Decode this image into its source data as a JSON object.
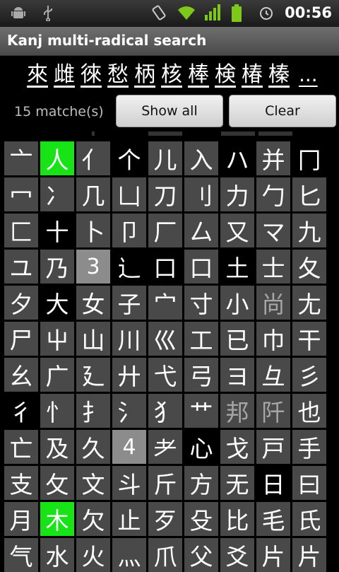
{
  "status_bar": {
    "time": "00:56",
    "icons": [
      "android-debug-icon",
      "usb-icon",
      "vibrate-icon",
      "wifi-icon",
      "signal-icon",
      "battery-icon",
      "alarm-icon"
    ]
  },
  "app": {
    "title": "Kanj multi-radical search"
  },
  "results": {
    "kanji": [
      "來",
      "雌",
      "徠",
      "愁",
      "柄",
      "核",
      "棒",
      "検",
      "椿",
      "榛"
    ],
    "more": "..."
  },
  "controls": {
    "matches_text": "15 matche(s)",
    "show_all_label": "Show all",
    "clear_label": "Clear"
  },
  "radicals": [
    {
      "c": "亠",
      "s": "normal"
    },
    {
      "c": "人",
      "s": "selected"
    },
    {
      "c": "亻",
      "s": "normal"
    },
    {
      "c": "个",
      "s": "black"
    },
    {
      "c": "儿",
      "s": "normal"
    },
    {
      "c": "入",
      "s": "normal"
    },
    {
      "c": "ハ",
      "s": "black"
    },
    {
      "c": "并",
      "s": "normal"
    },
    {
      "c": "冂",
      "s": "black"
    },
    {
      "c": "冖",
      "s": "normal"
    },
    {
      "c": "冫",
      "s": "normal"
    },
    {
      "c": "几",
      "s": "normal"
    },
    {
      "c": "凵",
      "s": "normal"
    },
    {
      "c": "刀",
      "s": "normal"
    },
    {
      "c": "刂",
      "s": "normal"
    },
    {
      "c": "力",
      "s": "normal"
    },
    {
      "c": "勹",
      "s": "normal"
    },
    {
      "c": "匕",
      "s": "normal"
    },
    {
      "c": "匚",
      "s": "normal"
    },
    {
      "c": "十",
      "s": "black"
    },
    {
      "c": "卜",
      "s": "normal"
    },
    {
      "c": "卩",
      "s": "normal"
    },
    {
      "c": "厂",
      "s": "normal"
    },
    {
      "c": "厶",
      "s": "normal"
    },
    {
      "c": "又",
      "s": "normal"
    },
    {
      "c": "マ",
      "s": "normal"
    },
    {
      "c": "九",
      "s": "normal"
    },
    {
      "c": "ユ",
      "s": "normal"
    },
    {
      "c": "乃",
      "s": "normal"
    },
    {
      "c": "3",
      "s": "number"
    },
    {
      "c": "⻌",
      "s": "black"
    },
    {
      "c": "口",
      "s": "black"
    },
    {
      "c": "口",
      "s": "normal"
    },
    {
      "c": "土",
      "s": "black"
    },
    {
      "c": "士",
      "s": "normal"
    },
    {
      "c": "夂",
      "s": "normal"
    },
    {
      "c": "夕",
      "s": "normal"
    },
    {
      "c": "大",
      "s": "black"
    },
    {
      "c": "女",
      "s": "normal"
    },
    {
      "c": "子",
      "s": "normal"
    },
    {
      "c": "宀",
      "s": "normal"
    },
    {
      "c": "寸",
      "s": "normal"
    },
    {
      "c": "小",
      "s": "normal"
    },
    {
      "c": "尚",
      "s": "dim"
    },
    {
      "c": "尢",
      "s": "normal"
    },
    {
      "c": "尸",
      "s": "normal"
    },
    {
      "c": "屮",
      "s": "normal"
    },
    {
      "c": "山",
      "s": "normal"
    },
    {
      "c": "川",
      "s": "normal"
    },
    {
      "c": "巛",
      "s": "normal"
    },
    {
      "c": "工",
      "s": "normal"
    },
    {
      "c": "已",
      "s": "normal"
    },
    {
      "c": "巾",
      "s": "normal"
    },
    {
      "c": "干",
      "s": "normal"
    },
    {
      "c": "幺",
      "s": "normal"
    },
    {
      "c": "广",
      "s": "normal"
    },
    {
      "c": "廴",
      "s": "normal"
    },
    {
      "c": "廾",
      "s": "normal"
    },
    {
      "c": "弋",
      "s": "normal"
    },
    {
      "c": "弓",
      "s": "normal"
    },
    {
      "c": "ヨ",
      "s": "normal"
    },
    {
      "c": "彑",
      "s": "normal"
    },
    {
      "c": "彡",
      "s": "normal"
    },
    {
      "c": "彳",
      "s": "black"
    },
    {
      "c": "忄",
      "s": "normal"
    },
    {
      "c": "扌",
      "s": "normal"
    },
    {
      "c": "氵",
      "s": "normal"
    },
    {
      "c": "犭",
      "s": "normal"
    },
    {
      "c": "艹",
      "s": "normal"
    },
    {
      "c": "邦",
      "s": "dim"
    },
    {
      "c": "阡",
      "s": "dim"
    },
    {
      "c": "也",
      "s": "normal"
    },
    {
      "c": "亡",
      "s": "normal"
    },
    {
      "c": "及",
      "s": "normal"
    },
    {
      "c": "久",
      "s": "normal"
    },
    {
      "c": "4",
      "s": "number"
    },
    {
      "c": "耂",
      "s": "normal"
    },
    {
      "c": "心",
      "s": "black"
    },
    {
      "c": "戈",
      "s": "normal"
    },
    {
      "c": "戸",
      "s": "normal"
    },
    {
      "c": "手",
      "s": "normal"
    },
    {
      "c": "支",
      "s": "normal"
    },
    {
      "c": "攵",
      "s": "normal"
    },
    {
      "c": "文",
      "s": "normal"
    },
    {
      "c": "斗",
      "s": "normal"
    },
    {
      "c": "斤",
      "s": "normal"
    },
    {
      "c": "方",
      "s": "normal"
    },
    {
      "c": "无",
      "s": "normal"
    },
    {
      "c": "日",
      "s": "black"
    },
    {
      "c": "曰",
      "s": "normal"
    },
    {
      "c": "月",
      "s": "normal"
    },
    {
      "c": "木",
      "s": "selected"
    },
    {
      "c": "欠",
      "s": "normal"
    },
    {
      "c": "止",
      "s": "normal"
    },
    {
      "c": "歹",
      "s": "normal"
    },
    {
      "c": "殳",
      "s": "normal"
    },
    {
      "c": "比",
      "s": "normal"
    },
    {
      "c": "毛",
      "s": "normal"
    },
    {
      "c": "氏",
      "s": "normal"
    },
    {
      "c": "气",
      "s": "normal"
    },
    {
      "c": "水",
      "s": "normal"
    },
    {
      "c": "火",
      "s": "normal"
    },
    {
      "c": "灬",
      "s": "normal"
    },
    {
      "c": "爪",
      "s": "normal"
    },
    {
      "c": "父",
      "s": "normal"
    },
    {
      "c": "爻",
      "s": "normal"
    },
    {
      "c": "片",
      "s": "normal"
    },
    {
      "c": "片",
      "s": "normal"
    }
  ]
}
